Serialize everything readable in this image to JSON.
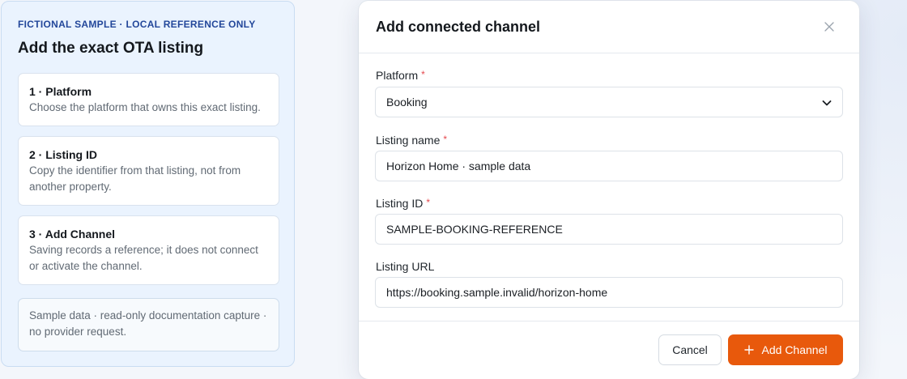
{
  "guide": {
    "eyebrow": "FICTIONAL SAMPLE · LOCAL REFERENCE ONLY",
    "title": "Add the exact OTA listing",
    "steps": [
      {
        "title": "1 · Platform",
        "text": "Choose the platform that owns this exact listing."
      },
      {
        "title": "2 · Listing ID",
        "text": "Copy the identifier from that listing, not from another property."
      },
      {
        "title": "3 · Add Channel",
        "text": "Saving records a reference; it does not connect or activate the channel."
      }
    ],
    "note": "Sample data · read-only documentation capture · no provider request."
  },
  "dialog": {
    "title": "Add connected channel",
    "fields": {
      "platform": {
        "label": "Platform",
        "required_mark": "*",
        "value": "Booking"
      },
      "listing_name": {
        "label": "Listing name",
        "required_mark": "*",
        "value": "Horizon Home · sample data"
      },
      "listing_id": {
        "label": "Listing ID",
        "required_mark": "*",
        "value": "SAMPLE-BOOKING-REFERENCE"
      },
      "listing_url": {
        "label": "Listing URL",
        "value": "https://booking.sample.invalid/horizon-home"
      }
    },
    "buttons": {
      "cancel": "Cancel",
      "add": "Add Channel"
    }
  },
  "icons": {
    "close": "close-icon",
    "chevron": "chevron-down-icon",
    "plus": "plus-icon"
  },
  "colors": {
    "accent": "#e8590c",
    "eyebrow": "#23479a",
    "required": "#e5484d",
    "panel": "#eaf3fe"
  }
}
